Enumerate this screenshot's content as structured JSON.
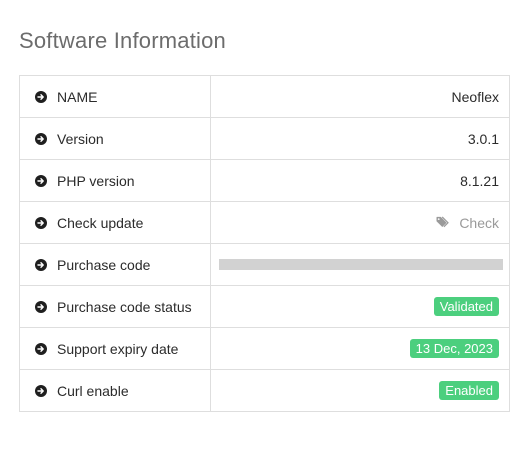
{
  "page_title": "Software Information",
  "rows": [
    {
      "label": "NAME",
      "value": "Neoflex"
    },
    {
      "label": "Version",
      "value": "3.0.1"
    },
    {
      "label": "PHP version",
      "value": "8.1.21"
    },
    {
      "label": "Check update",
      "value": "Check",
      "icon": "tag-icon"
    },
    {
      "label": "Purchase code",
      "value": ""
    },
    {
      "label": "Purchase code status",
      "value": "Validated"
    },
    {
      "label": "Support expiry date",
      "value": "13 Dec, 2023"
    },
    {
      "label": "Curl enable",
      "value": "Enabled"
    }
  ],
  "colors": {
    "badge_green": "#4ccf7e",
    "masked_bar": "#d2d2d2",
    "title_gray": "#6c6c6c",
    "link_gray": "#9a9a9a"
  },
  "row_icon": "arrow-right-circle-icon"
}
